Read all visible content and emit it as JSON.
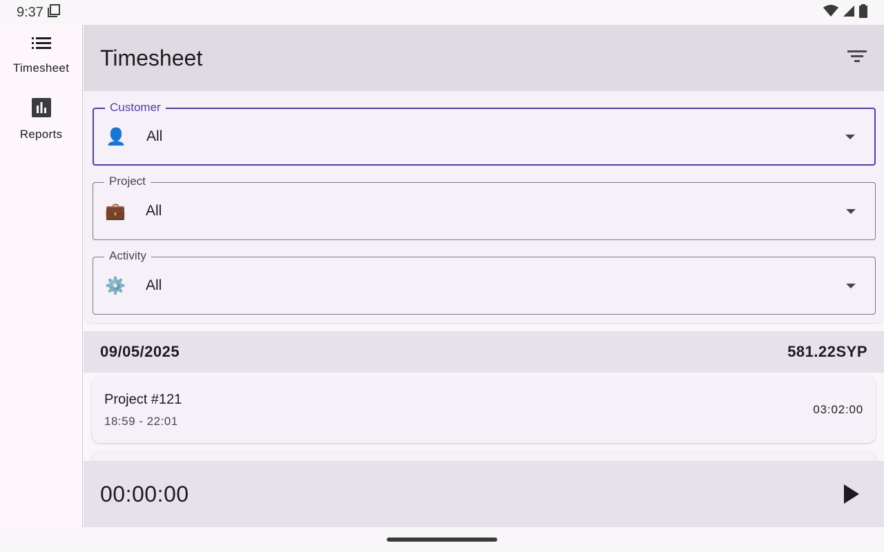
{
  "status_bar": {
    "time": "9:37",
    "icons": [
      "screen-icon",
      "wifi-icon",
      "signal-icon",
      "battery-icon"
    ]
  },
  "nav_rail": {
    "items": [
      {
        "label": "Timesheet",
        "icon": "list-icon"
      },
      {
        "label": "Reports",
        "icon": "bar-chart-icon"
      }
    ]
  },
  "app_bar": {
    "title": "Timesheet",
    "filter_icon": "filter-icon"
  },
  "filters": {
    "customer": {
      "label": "Customer",
      "value": "All",
      "icon": "👤"
    },
    "project": {
      "label": "Project",
      "value": "All",
      "icon": "💼"
    },
    "activity": {
      "label": "Activity",
      "value": "All",
      "icon": "⚙️"
    }
  },
  "day_group": {
    "date": "09/05/2025",
    "total": "581.22SYP"
  },
  "entries": [
    {
      "title": "Project #121",
      "time_range": "18:59 - 22:01",
      "duration": "03:02:00"
    }
  ],
  "timer": {
    "value": "00:00:00"
  },
  "colors": {
    "accent": "#4f3ea5",
    "app_bar_bg": "#e0dbe3",
    "rail_bg": "#fdf7fc"
  }
}
